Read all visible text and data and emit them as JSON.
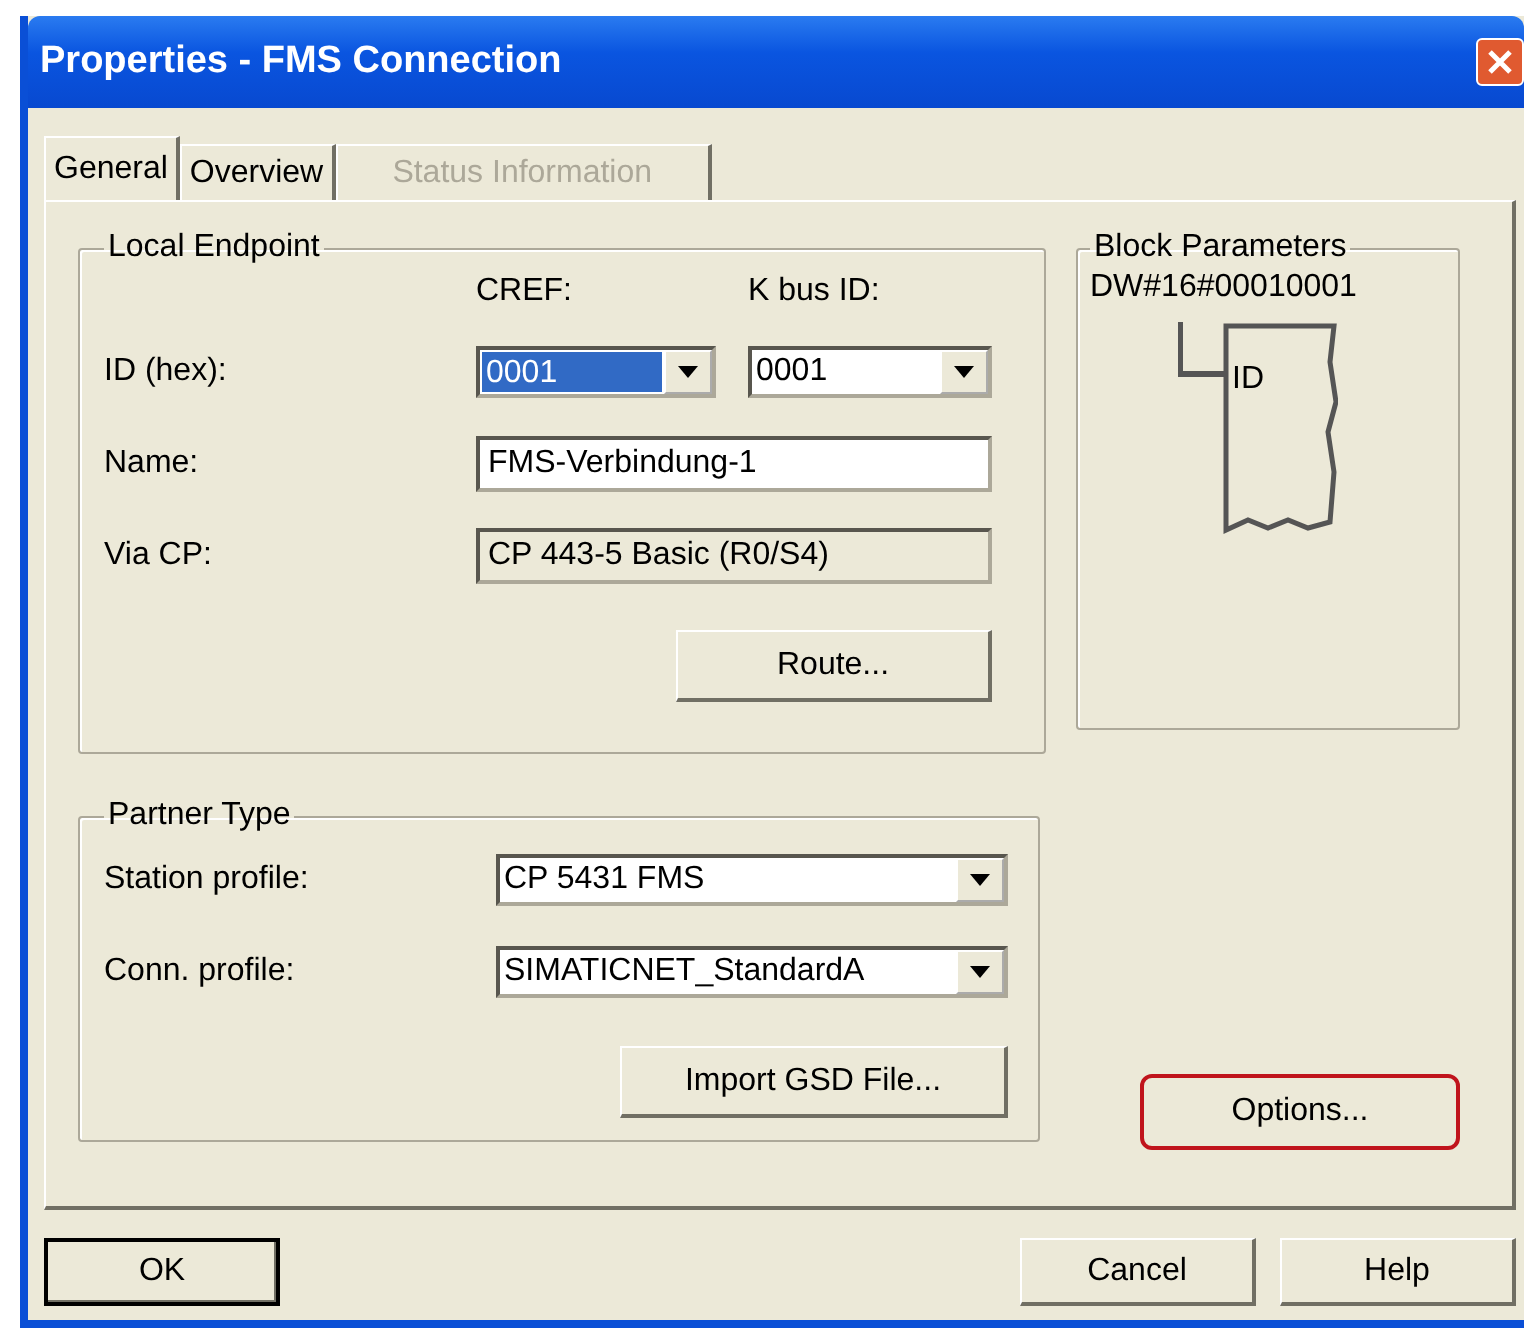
{
  "window": {
    "title": "Properties - FMS Connection"
  },
  "tabs": [
    {
      "label": "General",
      "selected": true,
      "disabled": false
    },
    {
      "label": "Overview",
      "selected": false,
      "disabled": false
    },
    {
      "label": "Status Information",
      "selected": false,
      "disabled": true
    }
  ],
  "local_endpoint": {
    "title": "Local Endpoint",
    "column_headers": [
      "CREF:",
      "K bus ID:"
    ],
    "fields": [
      {
        "kind": "combo-pair",
        "label": "ID (hex):",
        "combos": [
          {
            "value": "0001",
            "highlighted": true
          },
          {
            "value": "0001",
            "highlighted": false
          }
        ]
      },
      {
        "kind": "text",
        "label": "Name:",
        "value": "FMS-Verbindung-1",
        "readonly": false
      },
      {
        "kind": "text",
        "label": "Via CP:",
        "value": "CP 443-5 Basic (R0/S4)",
        "readonly": true
      }
    ],
    "button": "Route..."
  },
  "block_parameters": {
    "title": "Block Parameters",
    "value": "DW#16#00010001",
    "pin_label": "ID"
  },
  "partner_type": {
    "title": "Partner Type",
    "fields": [
      {
        "label": "Station profile:",
        "value": "CP 5431 FMS"
      },
      {
        "label": "Conn. profile:",
        "value": "SIMATICNET_StandardA"
      }
    ],
    "button": "Import GSD File..."
  },
  "options_button": {
    "label": "Options...",
    "highlighted": true
  },
  "buttons": [
    {
      "label": "OK",
      "default": true
    },
    {
      "label": "Cancel",
      "default": false
    },
    {
      "label": "Help",
      "default": false
    }
  ]
}
